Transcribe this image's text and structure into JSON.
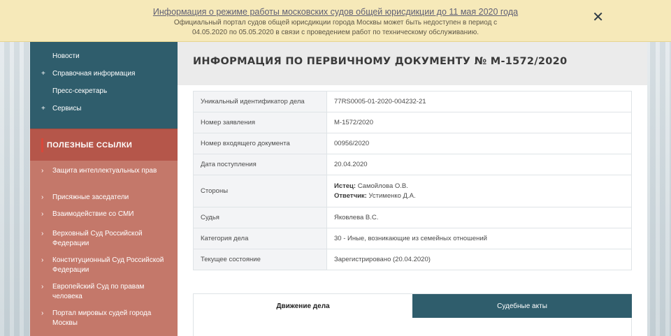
{
  "notice": {
    "title": "Информация о режиме работы московских судов общей юрисдикции до 11 мая 2020 года",
    "line1": "Официальный портал судов общей юрисдикции города Москвы может быть недоступен в период с",
    "line2": "04.05.2020 по 05.05.2020 в связи с проведением работ по техническому обслуживанию.",
    "close_glyph": "✕"
  },
  "sidebar": {
    "nav_items": [
      {
        "label": "Новости",
        "has_plus": false
      },
      {
        "label": "Справочная информация",
        "has_plus": true
      },
      {
        "label": "Пресс-секретарь",
        "has_plus": false
      },
      {
        "label": "Сервисы",
        "has_plus": true
      }
    ],
    "plus_glyph": "+",
    "useful_links_title": "ПОЛЕЗНЫЕ ССЫЛКИ",
    "arrow_glyph": "›",
    "links": [
      "Защита интеллектуальных прав",
      "Присяжные заседатели",
      "Взаимодействие со СМИ",
      "Верховный Суд Российской Федерации",
      "Конституционный Суд Российской Федерации",
      "Европейский Суд по правам человека",
      "Портал мировых судей города Москвы"
    ]
  },
  "document": {
    "title": "ИНФОРМАЦИЯ ПО ПЕРВИЧНОМУ ДОКУМЕНТУ № М-1572/2020",
    "rows": [
      {
        "label": "Уникальный идентификатор дела",
        "value": "77RS0005-01-2020-004232-21"
      },
      {
        "label": "Номер заявления",
        "value": "М-1572/2020"
      },
      {
        "label": "Номер входящего документа",
        "value": "00956/2020"
      },
      {
        "label": "Дата поступления",
        "value": "20.04.2020"
      }
    ],
    "parties": {
      "label": "Стороны",
      "plaintiff_role": "Истец:",
      "plaintiff": "Самойлова О.В.",
      "defendant_role": "Ответчик:",
      "defendant": "Устименко Д.А."
    },
    "rows_after": [
      {
        "label": "Судья",
        "value": "Яковлева В.С."
      },
      {
        "label": "Категория дела",
        "value": "30 - Иные, возникающие из семейных отношений"
      },
      {
        "label": "Текущее состояние",
        "value": "Зарегистрировано (20.04.2020)"
      }
    ],
    "tabs": [
      {
        "label": "Движение дела",
        "active": true
      },
      {
        "label": "Судебные акты",
        "active": false
      }
    ]
  },
  "colors": {
    "accent_teal": "#2f5d6c",
    "links_header": "#b5564a",
    "links_body": "#c4786a",
    "notice_bg": "#f6e9b9"
  }
}
